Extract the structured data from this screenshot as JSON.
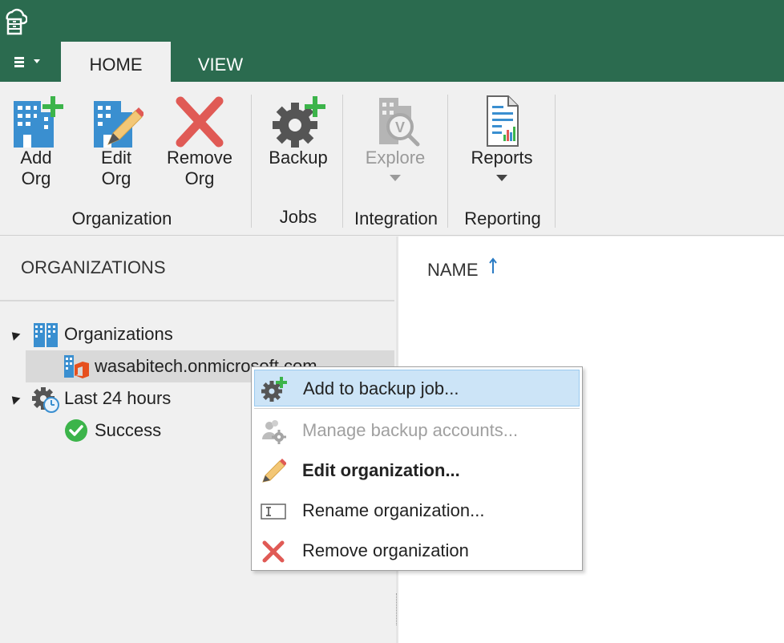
{
  "tabs": {
    "home": "HOME",
    "view": "VIEW"
  },
  "ribbon": {
    "add_org": [
      "Add",
      "Org"
    ],
    "edit_org": [
      "Edit",
      "Org"
    ],
    "remove_org": [
      "Remove",
      "Org"
    ],
    "backup": "Backup",
    "explore": "Explore",
    "reports": "Reports",
    "groups": {
      "organization": "Organization",
      "jobs": "Jobs",
      "integration": "Integration",
      "reporting": "Reporting"
    }
  },
  "left_panel": {
    "title": "ORGANIZATIONS",
    "tree": {
      "organizations": "Organizations",
      "org_item": "wasabitech.onmicrosoft.com",
      "last24": "Last 24 hours",
      "success": "Success"
    }
  },
  "right_panel": {
    "column_name": "NAME"
  },
  "context_menu": {
    "add_to_backup_job": "Add to backup job...",
    "manage_backup_accounts": "Manage backup accounts...",
    "edit_organization": "Edit organization...",
    "rename_organization": "Rename organization...",
    "remove_organization": "Remove organization"
  },
  "colors": {
    "title_bar": "#2b6b4f",
    "accent_blue": "#3a8fd0",
    "add_green": "#3cb44a",
    "remove_red": "#e05a55",
    "menu_hover": "#cce4f7"
  }
}
